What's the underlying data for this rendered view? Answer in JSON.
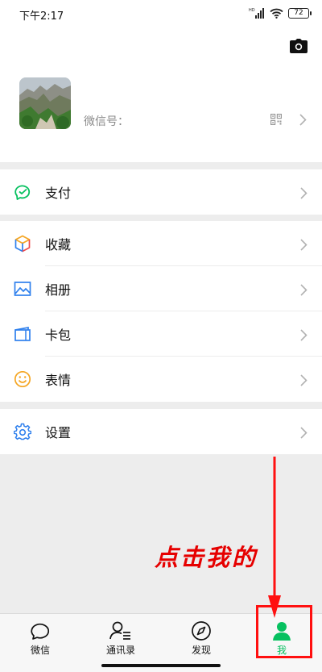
{
  "status_bar": {
    "time": "下午2:17",
    "network": "HD",
    "battery": "72"
  },
  "profile": {
    "wechat_id_label": "微信号："
  },
  "menu": {
    "pay": "支付",
    "favorites": "收藏",
    "album": "相册",
    "wallet": "卡包",
    "stickers": "表情",
    "settings": "设置"
  },
  "tabs": [
    "微信",
    "通讯录",
    "发现",
    "我"
  ],
  "active_tab": "我",
  "annotation": "点击我的",
  "colors": {
    "accent": "#07c160",
    "annotation": "#e60000",
    "background": "#ededed"
  }
}
